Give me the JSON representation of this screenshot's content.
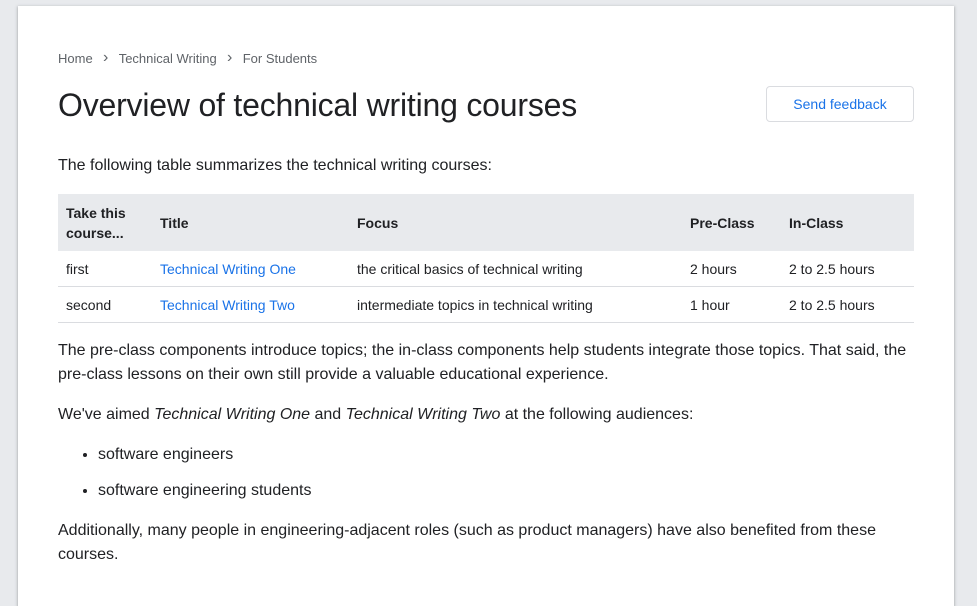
{
  "breadcrumb": [
    "Home",
    "Technical Writing",
    "For Students"
  ],
  "page_title": "Overview of technical writing courses",
  "feedback_button": "Send feedback",
  "intro": "The following table summarizes the technical writing courses:",
  "table": {
    "headers": [
      "Take this course...",
      "Title",
      "Focus",
      "Pre-Class",
      "In-Class"
    ],
    "rows": [
      [
        "first",
        "Technical Writing One",
        "the critical basics of technical writing",
        "2 hours",
        "2 to 2.5 hours"
      ],
      [
        "second",
        "Technical Writing Two",
        "intermediate topics in technical writing",
        "1 hour",
        "2 to 2.5 hours"
      ]
    ]
  },
  "paragraph1": "The pre-class components introduce topics; the in-class components help students integrate those topics. That said, the pre-class lessons on their own still provide a valuable educational experience.",
  "audience_intro": {
    "prefix": "We've aimed ",
    "course_one": "Technical Writing One",
    "joiner": " and ",
    "course_two": "Technical Writing Two",
    "suffix": " at the following audiences:"
  },
  "audiences": [
    "software engineers",
    "software engineering students"
  ],
  "paragraph3": "Additionally, many people in engineering-adjacent roles (such as product managers) have also benefited from these courses.",
  "icons": {
    "breadcrumb_separator": "chevron-right-icon"
  },
  "colors": {
    "link": "#1a73e8",
    "header_bg": "#e8eaed",
    "page_bg": "#e8eaed"
  }
}
